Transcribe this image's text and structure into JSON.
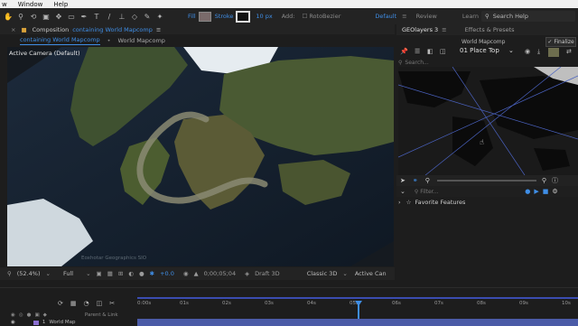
{
  "menu": {
    "partial": "w",
    "items": [
      "Window",
      "Help"
    ]
  },
  "toolbar": {
    "fill_label": "Fill",
    "fill_color": "#7a6a6a",
    "stroke_label": "Stroke",
    "stroke_width": "10 px",
    "add_label": "Add:",
    "rotobezier_label": "RotoBezier",
    "workspaces": [
      "Default",
      "Review",
      "Learn"
    ],
    "search_placeholder": "Search Help"
  },
  "composition": {
    "panel_title": "Composition",
    "panel_comp": "containing World Mapcomp",
    "active_tab": "containing World Mapcomp",
    "breadcrumb": "World Mapcomp",
    "camera_label": "Active Camera (Default)",
    "attribution": "Eoxhotar Geographics SIO"
  },
  "viewer_bar": {
    "zoom": "(52.4%)",
    "resolution": "Full",
    "exposure": "+0.0",
    "timecode": "0;00;05;04",
    "draft3d": "Draft 3D",
    "renderer": "Classic 3D",
    "camera": "Active Can"
  },
  "right_panel": {
    "tabs": [
      "GEOlayers 3",
      "Effects & Presets"
    ],
    "comp_name": "World Mapcomp",
    "finalize": "Finalize",
    "place_top": "01 Place Top",
    "search_placeholder": "Search...",
    "filter_placeholder": "Filter...",
    "favorite": "Favorite Features"
  },
  "timeline": {
    "ruler": [
      "0:00s",
      "01s",
      "02s",
      "03s",
      "04s",
      "05s",
      "06s",
      "07s",
      "08s",
      "09s",
      "10s"
    ],
    "layers": [
      "Parent & Link",
      "World Map"
    ]
  },
  "colors": {
    "accent": "#3f8ee6",
    "playhead": "#3f8ee6"
  }
}
